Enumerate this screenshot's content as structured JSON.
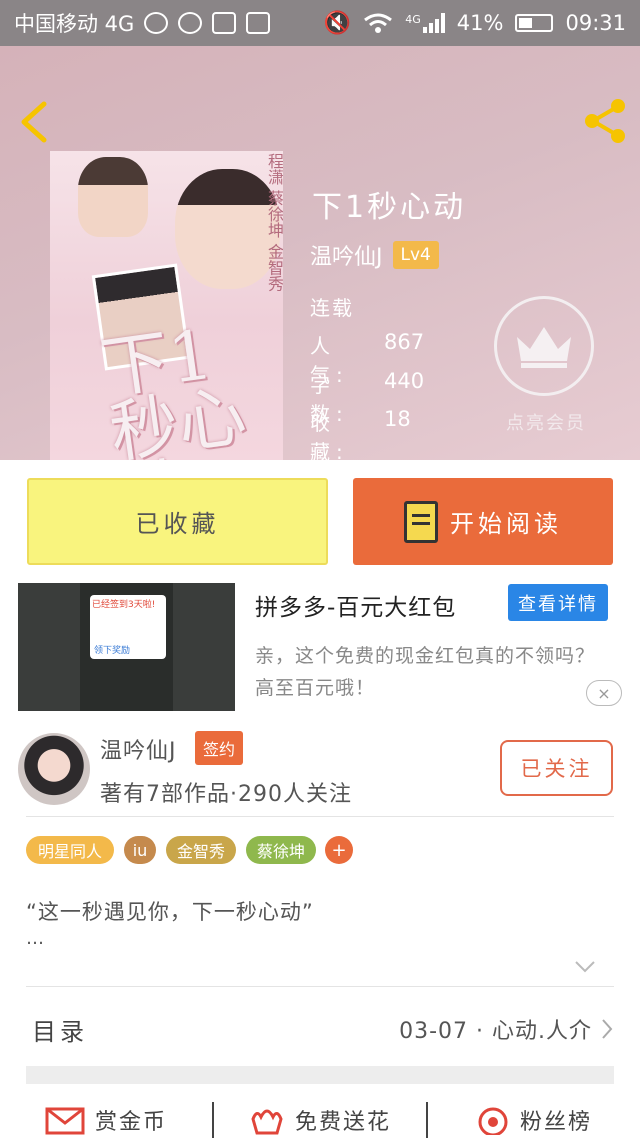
{
  "status_bar": {
    "carrier": "中国移动 4G",
    "network": "4G",
    "battery": "41%",
    "time": "09:31"
  },
  "book": {
    "title": "下1秒心动",
    "author": "温吟仙J",
    "level": "Lv4",
    "status": "连载",
    "stats": [
      {
        "label": "人气:",
        "value": "867"
      },
      {
        "label": "字数:",
        "value": "440"
      },
      {
        "label": "收藏:",
        "value": "18"
      }
    ],
    "vip_label": "点亮会员",
    "cover_title": "下1秒心动",
    "cover_side_text": "程潇 蔡徐坤 金智秀"
  },
  "actions": {
    "collect_label": "已收藏",
    "read_label": "开始阅读"
  },
  "ad": {
    "title": "拼多多-百元大红包",
    "detail_button": "查看详情",
    "description": "亲，这个免费的现金红包真的不领吗？高至百元哦！",
    "close_icon": "×",
    "image_text_top": "已经签到3天啦!",
    "image_text_button": "领下奖励"
  },
  "author_card": {
    "name": "温吟仙J",
    "badge": "签约",
    "works_info": "著有7部作品·290人关注",
    "follow_label": "已关注"
  },
  "tags": [
    {
      "label": "明星同人",
      "color": "#f3b94a"
    },
    {
      "label": "iu",
      "color": "#c58a4d"
    },
    {
      "label": "金智秀",
      "color": "#c9a64a"
    },
    {
      "label": "蔡徐坤",
      "color": "#8fb84d"
    }
  ],
  "tag_add_label": "+",
  "intro": {
    "text": "“这一秒遇见你，下一秒心动”",
    "more": "…"
  },
  "catalog": {
    "label": "目录",
    "latest": "03-07 · 心动.人介"
  },
  "bottom_bar": [
    {
      "label": "赏金币",
      "icon": "envelope-icon"
    },
    {
      "label": "免费送花",
      "icon": "flower-icon"
    },
    {
      "label": "粉丝榜",
      "icon": "ranking-icon"
    }
  ],
  "colors": {
    "accent": "#ea6b3b",
    "collect_bg": "#f9f47e",
    "link_blue": "#2a86e6",
    "level_badge": "#f3b94a"
  }
}
